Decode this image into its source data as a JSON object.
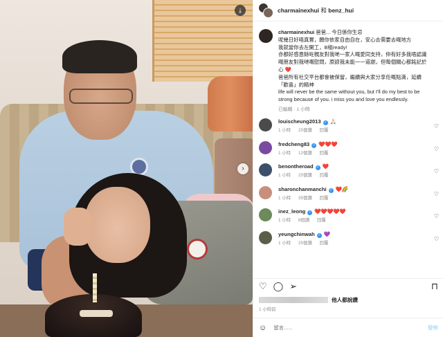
{
  "header": {
    "user1": "charmainexhui",
    "connector": "和",
    "user2": "benz_hui"
  },
  "caption": {
    "user": "charmainexhui",
    "lines": [
      "爸爸... 今日係你生忌",
      "呢幾日好唔真實，願你依家自由自在，安心去需要去嘅地方",
      "我就當你去左開工，B組ready!",
      "亦都好感恩餘咗親友對我哋一家人嘅愛同支持，仲有好多我唔認識",
      "嘅朋友對我哋嘅慰問，原諒我未能一一道謝，但每個關心都銘記於",
      "心 ❤️",
      "爸爸所有社交平台都會被保留，繼續與大家分享佢嘅點滴，延續",
      "「歡喜」的精神",
      "life will never be the same without you, but I'll do my best to be",
      "strong because of you. i miss you and love you endlessly."
    ],
    "meta": "已編輯 · 1 小時"
  },
  "comments": [
    {
      "user": "louischeung2013",
      "verified": true,
      "text": "🙏🏻",
      "time": "1 小時",
      "likes": "25個讚",
      "reply": "回覆",
      "avatar_color": "#4b4b4b"
    },
    {
      "user": "fredcheng83",
      "verified": true,
      "text": "❤️❤️❤️",
      "time": "1 小時",
      "likes": "12個讚",
      "reply": "回覆",
      "avatar_color": "#7a4aa0"
    },
    {
      "user": "benontheroad",
      "verified": true,
      "text": "❤️",
      "time": "1 小時",
      "likes": "25個讚",
      "reply": "回覆",
      "avatar_color": "#3d4f6a"
    },
    {
      "user": "sharonchanmanchi",
      "verified": true,
      "text": "❤️🌈",
      "time": "1 小時",
      "likes": "35個讚",
      "reply": "回覆",
      "avatar_color": "#c98f7c"
    },
    {
      "user": "inez_leong",
      "verified": true,
      "text": "❤️❤️❤️❤️❤️",
      "time": "1 小時",
      "likes": "8個讚",
      "reply": "回覆",
      "avatar_color": "#6c8a5a"
    },
    {
      "user": "yeungchinwah",
      "verified": true,
      "text": "💜",
      "time": "1 小時",
      "likes": "25個讚",
      "reply": "回覆",
      "avatar_color": "#5b5f4a"
    }
  ],
  "icons": {
    "like": "heart-icon",
    "comment": "comment-icon",
    "share": "share-icon",
    "save": "bookmark-icon",
    "download": "download-icon",
    "next": "chevron-right-icon",
    "emoji": "emoji-icon"
  },
  "likes": {
    "others": "他人都說讚"
  },
  "time": "1 小時前",
  "comment_box": {
    "placeholder": "留言......",
    "post": "發佈"
  },
  "colors": {
    "link": "#0095f6",
    "verified": "#3897f0",
    "muted": "#8e8e8e"
  }
}
